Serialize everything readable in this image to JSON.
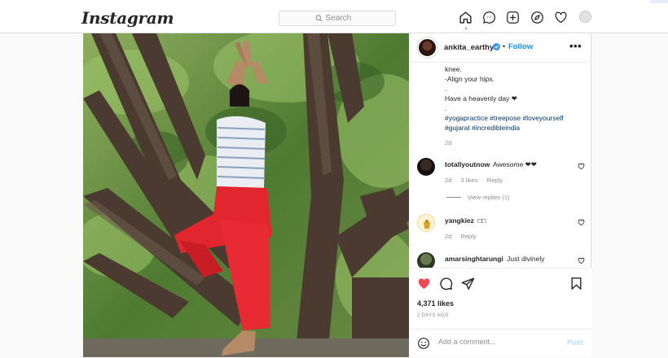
{
  "app": {
    "logo_text": "Instagram"
  },
  "search": {
    "placeholder": "Search"
  },
  "nav": {
    "icons": [
      "home-icon",
      "direct-messages-icon",
      "new-post-icon",
      "explore-icon",
      "activity-heart-icon",
      "profile-avatar"
    ]
  },
  "post": {
    "username": "ankita_earthy",
    "separator": "•",
    "follow_label": "Follow",
    "more_label": "•••",
    "caption_lines": {
      "l1": "knee.",
      "l2": "-Align your hips.",
      "l3": ".",
      "l4": "Have a heavenly day ❤",
      "l5": "."
    },
    "hashtags": {
      "h1": "#yogapractice",
      "h2": "#treepose",
      "h3": "#loveyourself",
      "h4": "#gujarat",
      "h5": "#incredibleindia"
    },
    "caption_age": "2d",
    "likes_text": "4,371 likes",
    "posted_time": "2 DAYS AGO"
  },
  "comments": [
    {
      "username": "totallyoutnow",
      "text": "Awesome ❤❤",
      "age": "2d",
      "likes": "3 likes",
      "reply_label": "Reply",
      "view_replies": "View replies (1)"
    },
    {
      "username": "yangkiez",
      "text": "□□",
      "age": "2d",
      "reply_label": "Reply"
    },
    {
      "username": "amarsinghtarungi",
      "text": "Just divinely"
    }
  ],
  "composer": {
    "placeholder": "Add a comment...",
    "post_label": "Post"
  },
  "colors": {
    "accent": "#0095f6",
    "liked": "#ed4956",
    "hashtag": "#00376b",
    "muted": "#8e8e8e"
  }
}
